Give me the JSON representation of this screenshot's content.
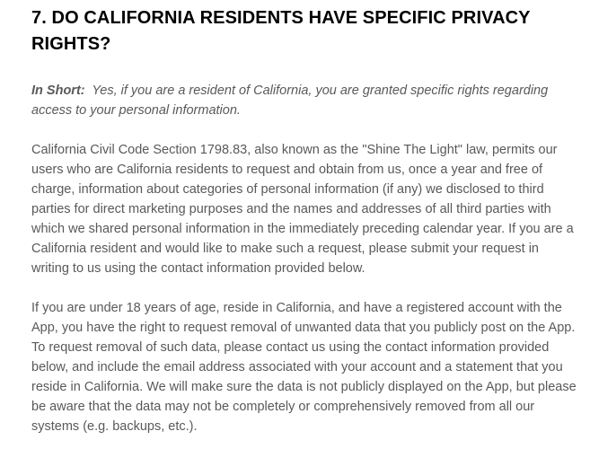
{
  "section": {
    "title": "7. DO CALIFORNIA RESIDENTS HAVE SPECIFIC PRIVACY RIGHTS?",
    "summary": {
      "lead": "In Short:",
      "text": "Yes, if you are a resident of California, you are granted specific rights regarding access to your personal information."
    },
    "paragraphs": [
      "California Civil Code Section 1798.83, also known as the \"Shine The Light\" law, permits our users who are California residents to request and obtain from us, once a year and free of charge, information about categories of personal information (if any) we disclosed to third parties for direct marketing purposes and the names and addresses of all third parties with which we shared personal information in the immediately preceding calendar year. If you are a California resident and would like to make such a request, please submit your request in writing to us using the contact information provided below.",
      "If you are under 18 years of age, reside in California, and have a registered account with the App, you have the right to request removal of unwanted data that you publicly post on the App. To request removal of such data, please contact us using the contact information provided below, and include the email address associated with your account and a statement that you reside in California. We will make sure the data is not publicly displayed on the App, but please be aware that the data may not be completely or comprehensively removed from all our systems (e.g. backups, etc.)."
    ]
  }
}
